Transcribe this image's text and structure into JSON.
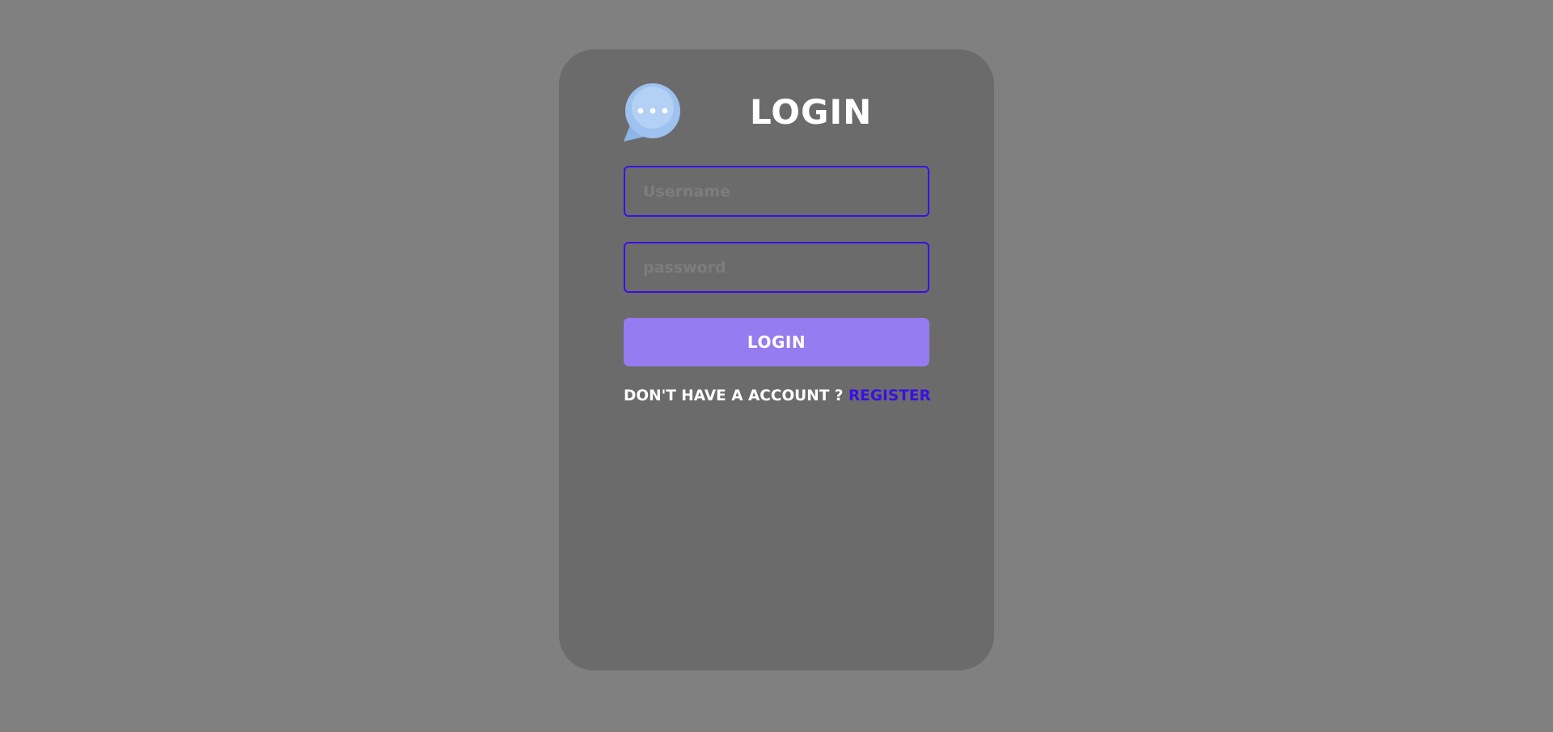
{
  "form": {
    "title": "LOGIN",
    "username_placeholder": "Username",
    "password_placeholder": "password",
    "login_button": "LOGIN",
    "account_prompt": "DON'T HAVE A ACCOUNT ?",
    "register_link": "REGISTER"
  },
  "icons": {
    "logo": "chat-bubble-icon"
  },
  "colors": {
    "page_background": "#808080",
    "card_background": "#6b6b6b",
    "input_border": "#3a10e5",
    "button_background": "#977bf0",
    "register_link": "#3a10e5",
    "logo_bubble": "#9ec2ef"
  }
}
